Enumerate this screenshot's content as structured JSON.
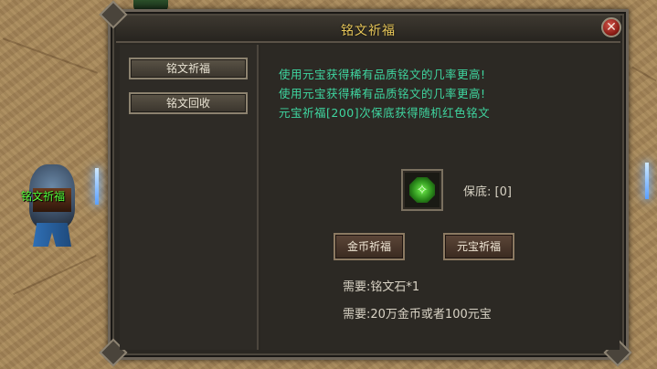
{
  "window": {
    "title": "铭文祈福",
    "close_icon": "close-icon"
  },
  "sidebar": {
    "items": [
      {
        "label": "铭文祈福"
      },
      {
        "label": "铭文回收"
      }
    ]
  },
  "info": {
    "lines": [
      "使用元宝获得稀有品质铭文的几率更高!",
      "使用元宝获得稀有品质铭文的几率更高!",
      "元宝祈福[200]次保底获得随机红色铭文"
    ]
  },
  "rune_slot": {
    "icon": "green-rune-icon",
    "guarantee_label": "保底: [0]"
  },
  "actions": {
    "gold_label": "金币祈福",
    "ingot_label": "元宝祈福"
  },
  "requirements": {
    "line1": "需要:铭文石*1",
    "line2": "需要:20万金币或者100元宝"
  },
  "npc": {
    "label": "铭文祈福"
  },
  "colors": {
    "title": "#e9c85a",
    "info_text": "#3fd6a0",
    "npc_label": "#55ff3a"
  }
}
